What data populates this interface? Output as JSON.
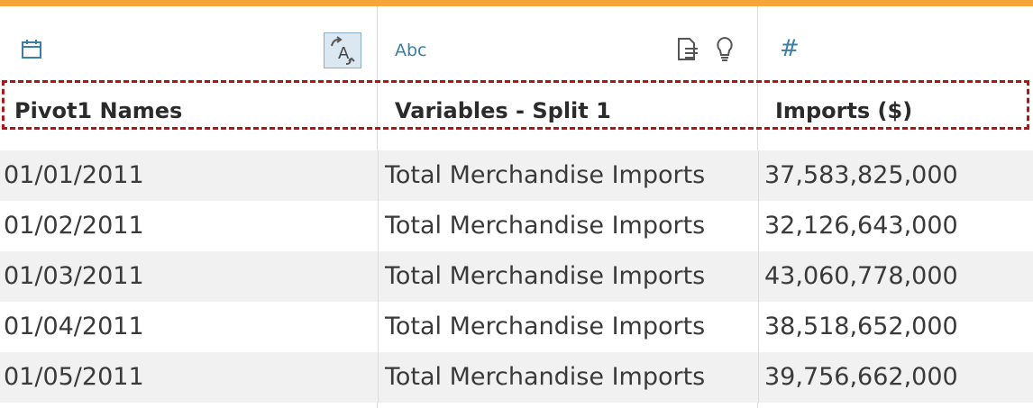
{
  "accent_color": "#f6a53b",
  "columns": [
    {
      "type_icon": "calendar-icon",
      "header": "Pivot1 Names"
    },
    {
      "type_icon": "abc-text-icon",
      "type_label": "Abc",
      "header": "Variables - Split 1"
    },
    {
      "type_icon": "hash-icon",
      "type_label": "#",
      "header": "Imports ($)"
    }
  ],
  "rows": [
    {
      "date": "01/01/2011",
      "variable": "Total Merchandise Imports",
      "imports": "37,583,825,000"
    },
    {
      "date": "01/02/2011",
      "variable": "Total Merchandise Imports",
      "imports": "32,126,643,000"
    },
    {
      "date": "01/03/2011",
      "variable": "Total Merchandise Imports",
      "imports": "43,060,778,000"
    },
    {
      "date": "01/04/2011",
      "variable": "Total Merchandise Imports",
      "imports": "38,518,652,000"
    },
    {
      "date": "01/05/2011",
      "variable": "Total Merchandise Imports",
      "imports": "39,756,662,000"
    }
  ],
  "highlight_color": "#b01515"
}
